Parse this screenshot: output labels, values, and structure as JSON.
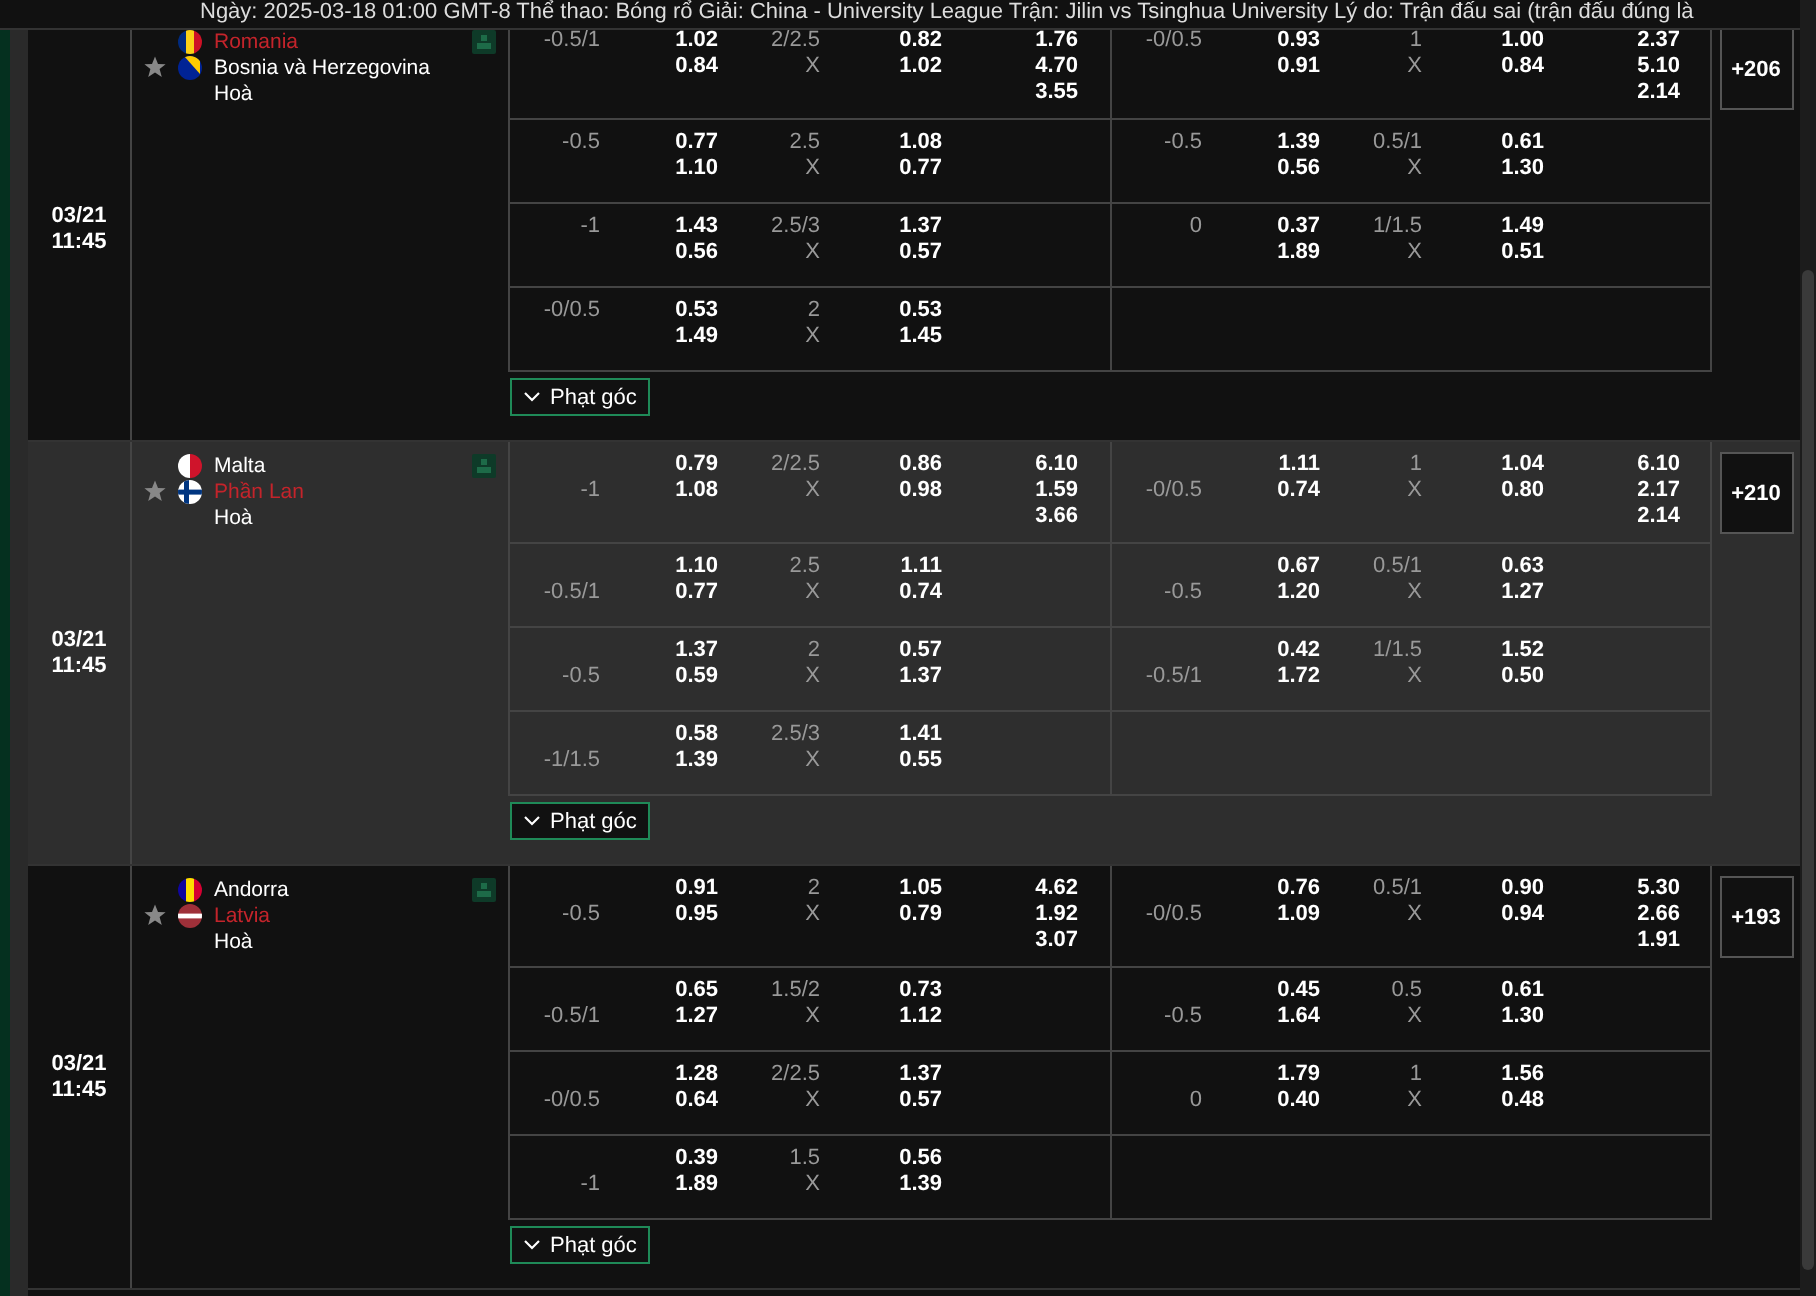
{
  "notice": "Ngày: 2025-03-18 01:00 GMT-8 Thể thao: Bóng rổ Giải: China - University League Trận: Jilin vs Tsinghua University Lý do: Trận đấu sai (trận đấu đúng là",
  "matches": [
    {
      "hovered": false,
      "date": "03/21",
      "time": "11:45",
      "favorite": false,
      "teams": [
        {
          "name": "Romania",
          "kind": "romania",
          "highlighted": true
        },
        {
          "name": "Bosnia và Herzegovina",
          "kind": "bosnia",
          "highlighted": false
        }
      ],
      "draw_label": "Hoà",
      "lines": [
        {
          "half1": {
            "hdp": "-0.5/1",
            "away_handicap": false,
            "hdp_odds": [
              "1.02",
              "0.84"
            ],
            "total": "2/2.5",
            "total_label": "X",
            "total_odds": [
              "0.82",
              "1.02"
            ],
            "result_odds": [
              "1.76",
              "4.70",
              "3.55"
            ]
          },
          "half2": {
            "hdp": "-0/0.5",
            "away_handicap": false,
            "hdp_odds": [
              "0.93",
              "0.91"
            ],
            "total": "1",
            "total_label": "X",
            "total_odds": [
              "1.00",
              "0.84"
            ],
            "result_odds": [
              "2.37",
              "5.10",
              "2.14"
            ]
          }
        },
        {
          "half1": {
            "hdp": "-0.5",
            "away_handicap": false,
            "hdp_odds": [
              "0.77",
              "1.10"
            ],
            "total": "2.5",
            "total_label": "X",
            "total_odds": [
              "1.08",
              "0.77"
            ]
          },
          "half2": {
            "hdp": "-0.5",
            "away_handicap": false,
            "hdp_odds": [
              "1.39",
              "0.56"
            ],
            "total": "0.5/1",
            "total_label": "X",
            "total_odds": [
              "0.61",
              "1.30"
            ]
          }
        },
        {
          "half1": {
            "hdp": "-1",
            "away_handicap": false,
            "hdp_odds": [
              "1.43",
              "0.56"
            ],
            "total": "2.5/3",
            "total_label": "X",
            "total_odds": [
              "1.37",
              "0.57"
            ]
          },
          "half2": {
            "hdp": "0",
            "away_handicap": false,
            "hdp_odds": [
              "0.37",
              "1.89"
            ],
            "total": "1/1.5",
            "total_label": "X",
            "total_odds": [
              "1.49",
              "0.51"
            ]
          }
        },
        {
          "half1": {
            "hdp": "-0/0.5",
            "away_handicap": false,
            "hdp_odds": [
              "0.53",
              "1.49"
            ],
            "total": "2",
            "total_label": "X",
            "total_odds": [
              "0.53",
              "1.45"
            ]
          }
        }
      ],
      "corner_button": "Phạt góc",
      "more": "+206"
    },
    {
      "hovered": true,
      "date": "03/21",
      "time": "11:45",
      "favorite": false,
      "teams": [
        {
          "name": "Malta",
          "kind": "malta",
          "highlighted": false
        },
        {
          "name": "Phần Lan",
          "kind": "finland",
          "highlighted": true
        }
      ],
      "draw_label": "Hoà",
      "lines": [
        {
          "half1": {
            "hdp": "-1",
            "away_handicap": true,
            "hdp_odds": [
              "0.79",
              "1.08"
            ],
            "total": "2/2.5",
            "total_label": "X",
            "total_odds": [
              "0.86",
              "0.98"
            ],
            "result_odds": [
              "6.10",
              "1.59",
              "3.66"
            ]
          },
          "half2": {
            "hdp": "-0/0.5",
            "away_handicap": true,
            "hdp_odds": [
              "1.11",
              "0.74"
            ],
            "total": "1",
            "total_label": "X",
            "total_odds": [
              "1.04",
              "0.80"
            ],
            "result_odds": [
              "6.10",
              "2.17",
              "2.14"
            ]
          }
        },
        {
          "half1": {
            "hdp": "-0.5/1",
            "away_handicap": true,
            "hdp_odds": [
              "1.10",
              "0.77"
            ],
            "total": "2.5",
            "total_label": "X",
            "total_odds": [
              "1.11",
              "0.74"
            ]
          },
          "half2": {
            "hdp": "-0.5",
            "away_handicap": true,
            "hdp_odds": [
              "0.67",
              "1.20"
            ],
            "total": "0.5/1",
            "total_label": "X",
            "total_odds": [
              "0.63",
              "1.27"
            ]
          }
        },
        {
          "half1": {
            "hdp": "-0.5",
            "away_handicap": true,
            "hdp_odds": [
              "1.37",
              "0.59"
            ],
            "total": "2",
            "total_label": "X",
            "total_odds": [
              "0.57",
              "1.37"
            ]
          },
          "half2": {
            "hdp": "-0.5/1",
            "away_handicap": true,
            "hdp_odds": [
              "0.42",
              "1.72"
            ],
            "total": "1/1.5",
            "total_label": "X",
            "total_odds": [
              "1.52",
              "0.50"
            ]
          }
        },
        {
          "half1": {
            "hdp": "-1/1.5",
            "away_handicap": true,
            "hdp_odds": [
              "0.58",
              "1.39"
            ],
            "total": "2.5/3",
            "total_label": "X",
            "total_odds": [
              "1.41",
              "0.55"
            ]
          }
        }
      ],
      "corner_button": "Phạt góc",
      "more": "+210"
    },
    {
      "hovered": false,
      "date": "03/21",
      "time": "11:45",
      "favorite": false,
      "teams": [
        {
          "name": "Andorra",
          "kind": "andorra",
          "highlighted": false
        },
        {
          "name": "Latvia",
          "kind": "latvia",
          "highlighted": true
        }
      ],
      "draw_label": "Hoà",
      "lines": [
        {
          "half1": {
            "hdp": "-0.5",
            "away_handicap": true,
            "hdp_odds": [
              "0.91",
              "0.95"
            ],
            "total": "2",
            "total_label": "X",
            "total_odds": [
              "1.05",
              "0.79"
            ],
            "result_odds": [
              "4.62",
              "1.92",
              "3.07"
            ]
          },
          "half2": {
            "hdp": "-0/0.5",
            "away_handicap": true,
            "hdp_odds": [
              "0.76",
              "1.09"
            ],
            "total": "0.5/1",
            "total_label": "X",
            "total_odds": [
              "0.90",
              "0.94"
            ],
            "result_odds": [
              "5.30",
              "2.66",
              "1.91"
            ]
          }
        },
        {
          "half1": {
            "hdp": "-0.5/1",
            "away_handicap": true,
            "hdp_odds": [
              "0.65",
              "1.27"
            ],
            "total": "1.5/2",
            "total_label": "X",
            "total_odds": [
              "0.73",
              "1.12"
            ]
          },
          "half2": {
            "hdp": "-0.5",
            "away_handicap": true,
            "hdp_odds": [
              "0.45",
              "1.64"
            ],
            "total": "0.5",
            "total_label": "X",
            "total_odds": [
              "0.61",
              "1.30"
            ]
          }
        },
        {
          "half1": {
            "hdp": "-0/0.5",
            "away_handicap": true,
            "hdp_odds": [
              "1.28",
              "0.64"
            ],
            "total": "2/2.5",
            "total_label": "X",
            "total_odds": [
              "1.37",
              "0.57"
            ]
          },
          "half2": {
            "hdp": "0",
            "away_handicap": true,
            "hdp_odds": [
              "1.79",
              "0.40"
            ],
            "total": "1",
            "total_label": "X",
            "total_odds": [
              "1.56",
              "0.48"
            ]
          }
        },
        {
          "half1": {
            "hdp": "-1",
            "away_handicap": true,
            "hdp_odds": [
              "0.39",
              "1.89"
            ],
            "total": "1.5",
            "total_label": "X",
            "total_odds": [
              "0.56",
              "1.39"
            ]
          }
        }
      ],
      "corner_button": "Phạt góc",
      "more": "+193"
    }
  ]
}
